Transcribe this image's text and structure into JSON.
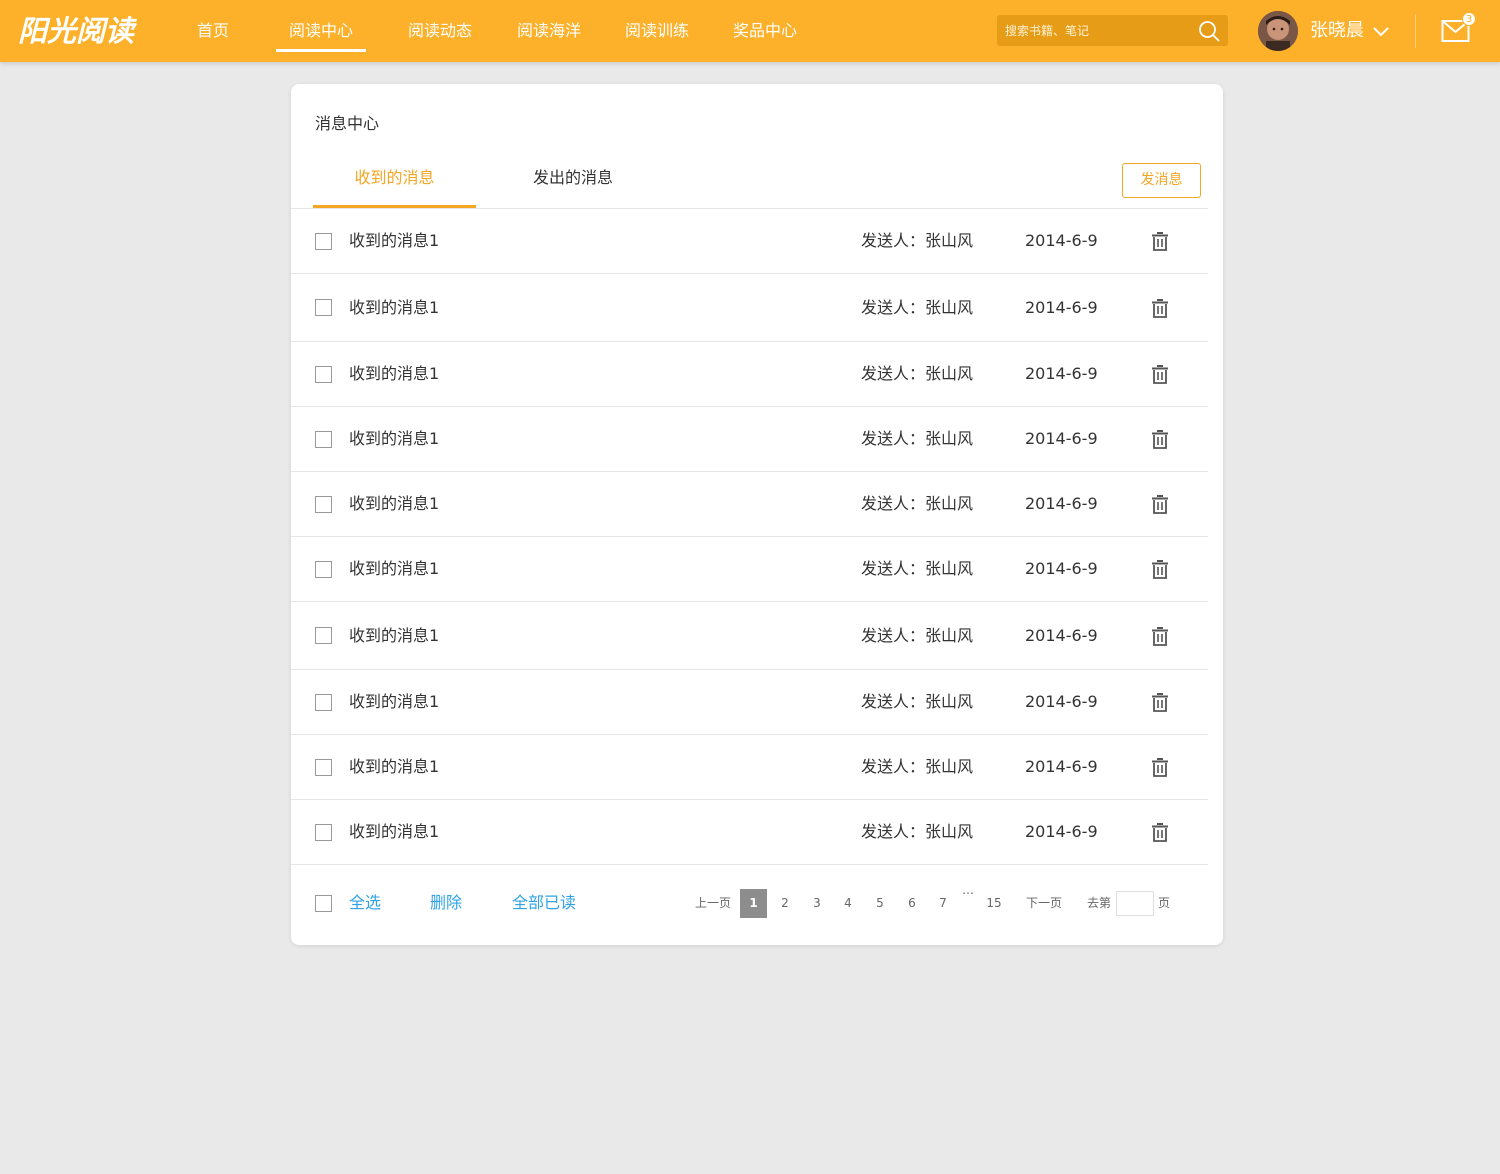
{
  "topbar": {
    "logo": "阳光阅读",
    "nav": [
      {
        "label": "首页"
      },
      {
        "label": "阅读中心"
      },
      {
        "label": "阅读动态"
      },
      {
        "label": "阅读海洋"
      },
      {
        "label": "阅读训练"
      },
      {
        "label": "奖品中心"
      }
    ],
    "active_nav": "阅读中心",
    "search_placeholder": "搜索书籍、笔记",
    "user_name": "张晓晨",
    "mail_badge": "3"
  },
  "card": {
    "title": "消息中心",
    "tabs": [
      {
        "label": "收到的消息"
      },
      {
        "label": "发出的消息"
      }
    ],
    "active_tab": "收到的消息",
    "send_button": "发消息",
    "messages": [
      {
        "title": "收到的消息1",
        "sender": "发送人：张山风",
        "date": "2014-6-9"
      },
      {
        "title": "收到的消息1",
        "sender": "发送人：张山风",
        "date": "2014-6-9"
      },
      {
        "title": "收到的消息1",
        "sender": "发送人：张山风",
        "date": "2014-6-9"
      },
      {
        "title": "收到的消息1",
        "sender": "发送人：张山风",
        "date": "2014-6-9"
      },
      {
        "title": "收到的消息1",
        "sender": "发送人：张山风",
        "date": "2014-6-9"
      },
      {
        "title": "收到的消息1",
        "sender": "发送人：张山风",
        "date": "2014-6-9"
      },
      {
        "title": "收到的消息1",
        "sender": "发送人：张山风",
        "date": "2014-6-9"
      },
      {
        "title": "收到的消息1",
        "sender": "发送人：张山风",
        "date": "2014-6-9"
      },
      {
        "title": "收到的消息1",
        "sender": "发送人：张山风",
        "date": "2014-6-9"
      },
      {
        "title": "收到的消息1",
        "sender": "发送人：张山风",
        "date": "2014-6-9"
      }
    ],
    "footer": {
      "select_all": "全选",
      "delete": "删除",
      "mark_all_read": "全部已读"
    },
    "pagination": {
      "prev": "上一页",
      "pages": [
        "1",
        "2",
        "3",
        "4",
        "5",
        "6",
        "7"
      ],
      "ellipsis": "…",
      "last": "15",
      "next": "下一页",
      "goto_prefix": "去第",
      "goto_suffix": "页",
      "current": "1"
    }
  },
  "colors": {
    "brand": "#fdb12a",
    "accent": "#f5a623",
    "link": "#2fa3e6"
  }
}
